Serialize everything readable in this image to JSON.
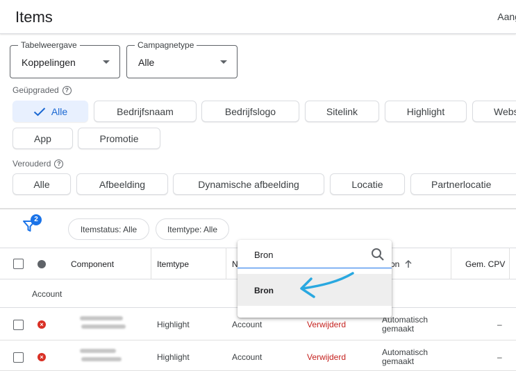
{
  "header": {
    "title": "Items",
    "right_text": "Aang"
  },
  "view_select": {
    "label": "Tabelweergave",
    "value": "Koppelingen"
  },
  "campaign_select": {
    "label": "Campagnetype",
    "value": "Alle"
  },
  "upgraded": {
    "label": "Geüpgraded",
    "chips": [
      "Alle",
      "Bedrijfsnaam",
      "Bedrijfslogo",
      "Sitelink",
      "Highlight",
      "Webs",
      "App",
      "Promotie"
    ]
  },
  "legacy": {
    "label": "Verouderd",
    "chips": [
      "Alle",
      "Afbeelding",
      "Dynamische afbeelding",
      "Locatie",
      "Partnerlocatie"
    ]
  },
  "filters": {
    "count": "2",
    "chips": [
      "Itemstatus: Alle",
      "Itemtype: Alle"
    ]
  },
  "table": {
    "columns": [
      "Component",
      "Itemtype",
      "N",
      "on",
      "Gem. CPV"
    ],
    "group_label": "Account",
    "rows": [
      {
        "type": "Highlight",
        "level": "Account",
        "status": "Verwijderd",
        "source": [
          "Automatisch",
          "gemaakt"
        ],
        "cpv": "–"
      },
      {
        "type": "Highlight",
        "level": "Account",
        "status": "Verwijderd",
        "source": [
          "Automatisch",
          "gemaakt"
        ],
        "cpv": "–"
      }
    ]
  },
  "column_popup": {
    "search_value": "Bron",
    "option": "Bron"
  },
  "colors": {
    "accent": "#1a73e8",
    "selected_chip_bg": "#e8f0fe",
    "removed": "#c5221f",
    "annotation": "#29a8e0"
  }
}
